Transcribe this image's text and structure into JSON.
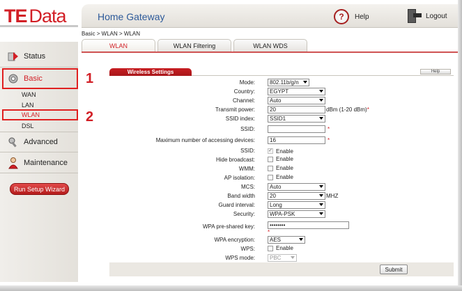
{
  "brand": {
    "logo_te": "TE",
    "logo_data": "Data"
  },
  "header": {
    "title": "Home Gateway",
    "help_label": "Help",
    "logout_label": "Logout"
  },
  "breadcrumb": "Basic > WLAN > WLAN",
  "tabs": [
    {
      "label": "WLAN",
      "active": true
    },
    {
      "label": "WLAN Filtering",
      "active": false
    },
    {
      "label": "WLAN WDS",
      "active": false
    }
  ],
  "sidebar": {
    "status": "Status",
    "basic": "Basic",
    "basic_sub": [
      "WAN",
      "LAN",
      "WLAN",
      "DSL"
    ],
    "advanced": "Advanced",
    "maintenance": "Maintenance",
    "wizard": "Run Setup Wizard"
  },
  "annotations": {
    "one": "1",
    "two": "2"
  },
  "panel": {
    "title": "Wireless Settings",
    "help": "Help"
  },
  "form": {
    "mode": {
      "label": "Mode:",
      "value": "802.11b/g/n"
    },
    "country": {
      "label": "Country:",
      "value": "EGYPT"
    },
    "channel": {
      "label": "Channel:",
      "value": "Auto"
    },
    "transmit_power": {
      "label": "Transmit power:",
      "value": "20",
      "unit": "dBm (1-20 dBm)",
      "star": "*"
    },
    "ssid_index": {
      "label": "SSID index:",
      "value": "SSID1"
    },
    "ssid": {
      "label": "SSID:",
      "value": "",
      "star": "*"
    },
    "max_devices": {
      "label": "Maximum number of accessing devices:",
      "value": "16",
      "star": "*"
    },
    "ssid_enable": {
      "label": "SSID:",
      "text": "Enable",
      "checked": true,
      "disabled": true
    },
    "hide_broadcast": {
      "label": "Hide broadcast:",
      "text": "Enable"
    },
    "wmm": {
      "label": "WMM:",
      "text": "Enable"
    },
    "ap_isolation": {
      "label": "AP isolation:",
      "text": "Enable"
    },
    "mcs": {
      "label": "MCS:",
      "value": "Auto"
    },
    "band_width": {
      "label": "Band width",
      "value": "20",
      "unit": "MHZ"
    },
    "guard_interval": {
      "label": "Guard interval:",
      "value": "Long"
    },
    "security": {
      "label": "Security:",
      "value": "WPA-PSK"
    },
    "wpa_key": {
      "label": "WPA pre-shared key:",
      "value": "••••••••",
      "star": "*"
    },
    "wpa_encryption": {
      "label": "WPA encryption:",
      "value": "AES"
    },
    "wps": {
      "label": "WPS:",
      "text": "Enable"
    },
    "wps_mode": {
      "label": "WPS mode:",
      "value": "PBC"
    },
    "submit": "Submit"
  },
  "colors": {
    "brand_red": "#d21f26",
    "title_blue": "#2d5a9a",
    "annotation_red": "#e02020"
  }
}
